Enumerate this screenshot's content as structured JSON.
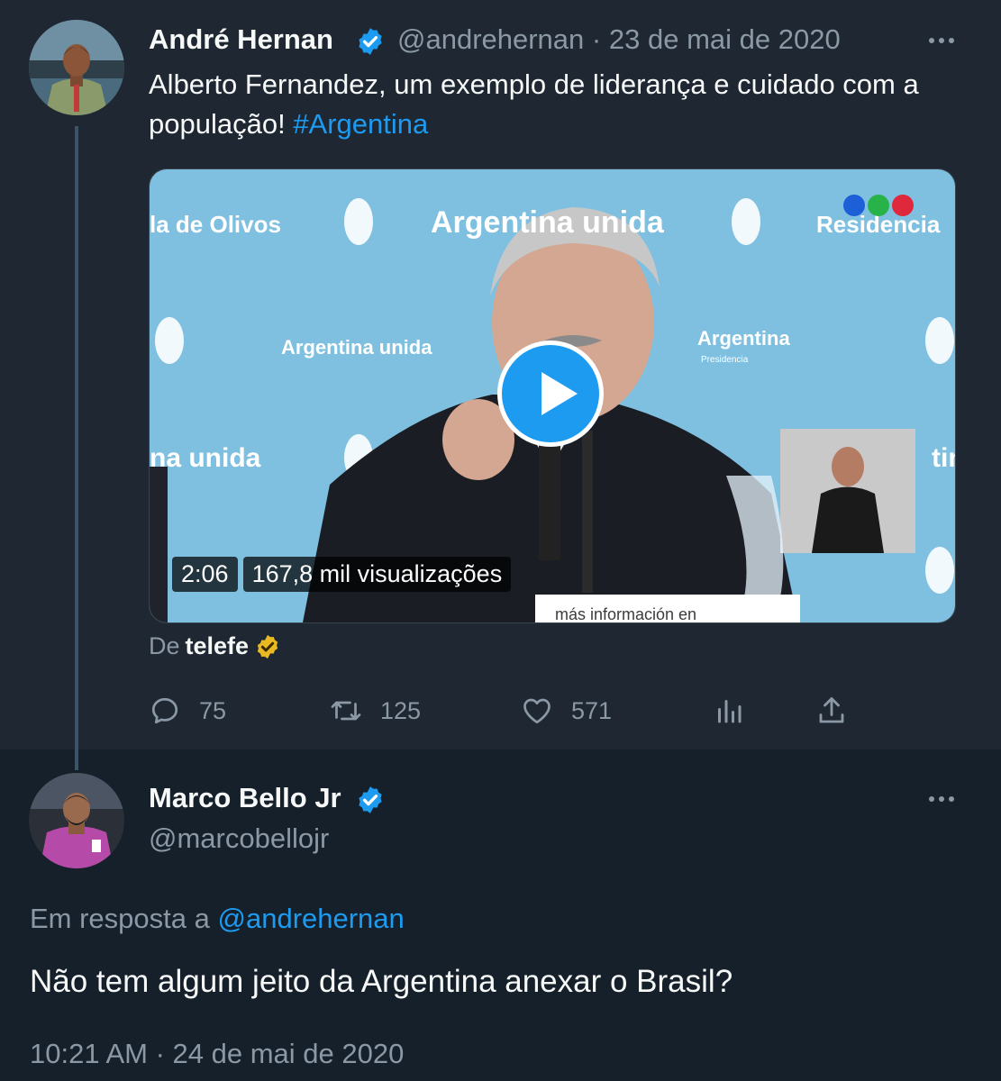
{
  "colors": {
    "background": "#15202b",
    "highlight": "#1e2732",
    "text": "#f7f9f9",
    "muted": "#8b98a5",
    "accent": "#1d9bf0",
    "verified_gold": "#e8b923"
  },
  "tweet": {
    "author_name": "André Hernan",
    "handle": "@andrehernan",
    "separator": "·",
    "date": "23 de mai de 2020",
    "text_part1": "Alberto Fernandez, um exemplo de liderança e cuidado com a população! ",
    "hashtag": "#Argentina",
    "media": {
      "duration": "2:06",
      "views": "167,8 mil visualizações",
      "background_texts": [
        "la de Olivos",
        "Argentina unida",
        "Residencia",
        "Argentina unida",
        "Argentina",
        "Presidencia",
        "na unida",
        "tin"
      ],
      "caption": "más información en",
      "play_icon": "play-icon"
    },
    "source_prefix": "De",
    "source_name": "telefe",
    "actions": {
      "replies": "75",
      "retweets": "125",
      "likes": "571"
    }
  },
  "reply": {
    "author_name": "Marco Bello Jr",
    "handle": "@marcobellojr",
    "reply_to_prefix": "Em resposta a",
    "reply_to_handle": "@andrehernan",
    "text": "Não tem algum jeito da Argentina anexar o Brasil?",
    "timestamp": "10:21 AM · 24 de mai de 2020"
  }
}
